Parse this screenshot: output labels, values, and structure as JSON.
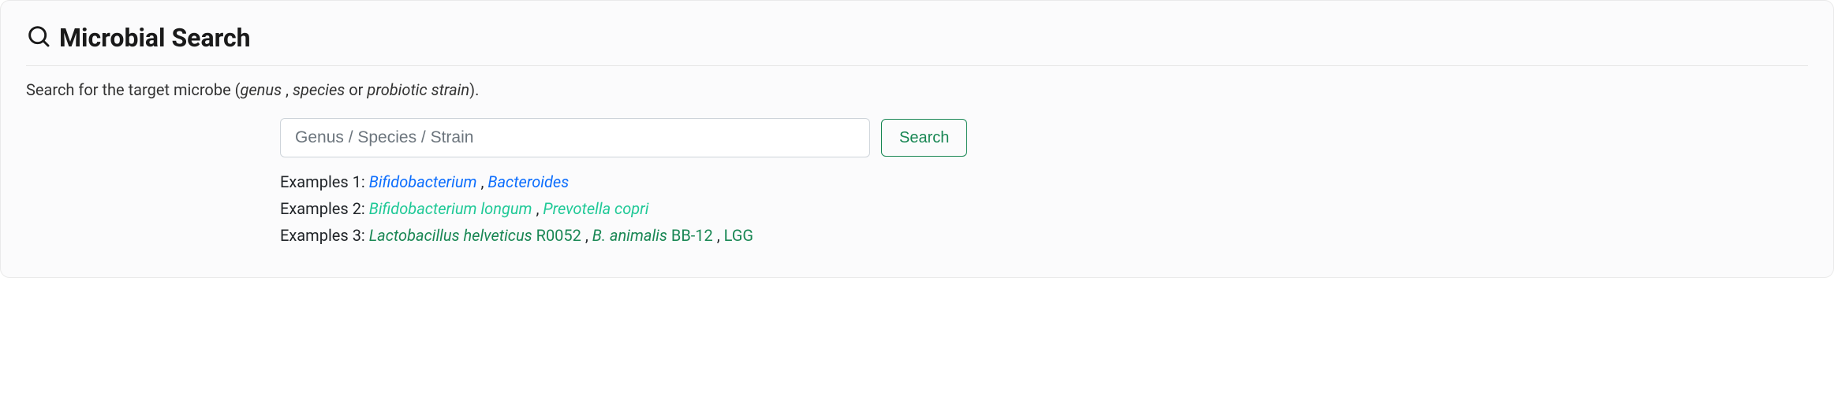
{
  "card": {
    "title": "Microbial Search"
  },
  "description": {
    "prefix": "Search for the target microbe (",
    "term1": "genus",
    "sep1": " , ",
    "term2": "species",
    "sep2": " or ",
    "term3": "probiotic strain",
    "suffix": ")."
  },
  "search": {
    "placeholder": "Genus / Species / Strain",
    "button": "Search"
  },
  "examples": {
    "row1": {
      "label": "Examples 1:  ",
      "link1": "Bifidobacterium",
      "sep1": " ,  ",
      "link2": "Bacteroides"
    },
    "row2": {
      "label": "Examples 2:  ",
      "link1": "Bifidobacterium longum",
      "sep1": " ,  ",
      "link2": "Prevotella copri"
    },
    "row3": {
      "label": "Examples 3:  ",
      "link1_italic": "Lactobacillus helveticus",
      "link1_rest": " R0052",
      "sep1": " ,  ",
      "link2_italic": "B. animalis",
      "link2_rest": " BB-12",
      "sep2": " ,  ",
      "link3": "LGG"
    }
  }
}
